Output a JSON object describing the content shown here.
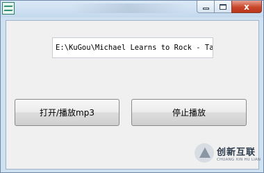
{
  "window": {
    "minimize_label": "",
    "close_label": "x"
  },
  "main": {
    "file_path": "E:\\KuGou\\Michael Learns to Rock - Take",
    "open_play_label": "打开/播放mp3",
    "stop_label": "停止播放"
  },
  "watermark": {
    "name": "创新互联",
    "tagline": "CHUANG XIN HU LIAN"
  }
}
